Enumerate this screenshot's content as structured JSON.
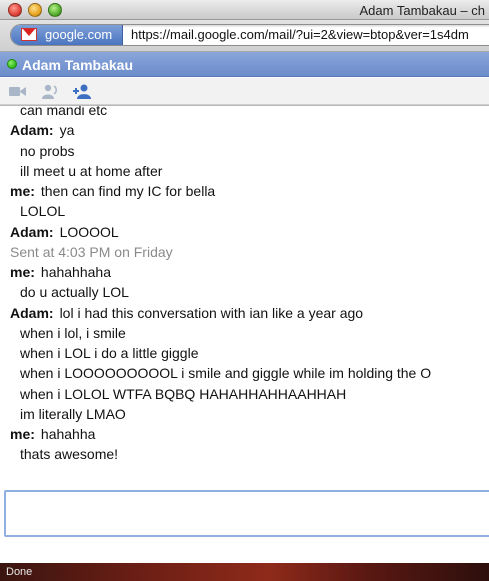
{
  "window": {
    "title": "Adam Tambakau – ch"
  },
  "address": {
    "site_name": "google.com",
    "url": "https://mail.google.com/mail/?ui=2&view=btop&ver=1s4dm"
  },
  "chat": {
    "contact_name": "Adam Tambakau",
    "status_color": "#2fb61a",
    "header_color": "#7a98d2",
    "toolbar_icons": [
      "video-icon",
      "voice-call-icon",
      "add-person-icon"
    ],
    "lines": [
      {
        "type": "cont",
        "speaker": "",
        "text": "can mandi etc"
      },
      {
        "type": "speaker",
        "speaker": "Adam:",
        "text": "ya"
      },
      {
        "type": "cont",
        "speaker": "",
        "text": "no probs"
      },
      {
        "type": "cont",
        "speaker": "",
        "text": "ill meet u at home after"
      },
      {
        "type": "speaker",
        "speaker": "me:",
        "text": "then can find my IC for bella"
      },
      {
        "type": "cont",
        "speaker": "",
        "text": "LOLOL"
      },
      {
        "type": "speaker",
        "speaker": "Adam:",
        "text": "LOOOOL"
      },
      {
        "type": "system",
        "speaker": "",
        "text": "Sent at 4:03 PM on Friday"
      },
      {
        "type": "speaker",
        "speaker": "me:",
        "text": "hahahhaha"
      },
      {
        "type": "cont",
        "speaker": "",
        "text": "do u actually LOL"
      },
      {
        "type": "speaker",
        "speaker": "Adam:",
        "text": "lol i had this conversation with ian like a year ago"
      },
      {
        "type": "cont",
        "speaker": "",
        "text": "when i lol, i smile"
      },
      {
        "type": "cont",
        "speaker": "",
        "text": "when i LOL i do a little giggle"
      },
      {
        "type": "cont",
        "speaker": "",
        "text": "when i LOOOOOOOOOL i smile and giggle while im holding the O"
      },
      {
        "type": "cont",
        "speaker": "",
        "text": "when i LOLOL WTFA BQBQ HAHAHHAHHAAHHAH"
      },
      {
        "type": "cont",
        "speaker": "",
        "text": "im literally LMAO"
      },
      {
        "type": "speaker",
        "speaker": "me:",
        "text": "hahahha"
      },
      {
        "type": "cont",
        "speaker": "",
        "text": "thats awesome!"
      }
    ],
    "input": {
      "value": ""
    }
  },
  "statusbar": {
    "text": "Done"
  }
}
